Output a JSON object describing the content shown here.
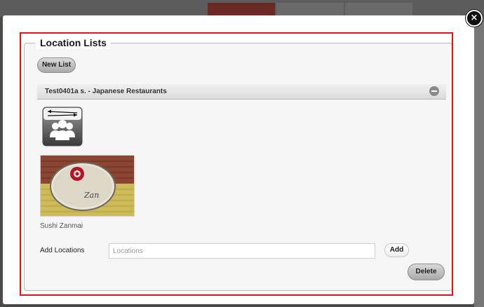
{
  "modal": {
    "close_label": "×",
    "section_title": "Location Lists",
    "new_list_label": "New List",
    "list": {
      "title": "Test0401a s. - Japanese Restaurants",
      "items": [
        {
          "name": "Sushi Zanmai"
        }
      ]
    },
    "add_locations_label": "Add Locations",
    "locations_placeholder": "Locations",
    "add_label": "Add",
    "delete_label": "Delete"
  },
  "colors": {
    "highlight": "#e1121b",
    "button_gradient_top": "#d9d9d9",
    "button_gradient_bottom": "#a9a9a9"
  },
  "icons": {
    "close": "close-icon",
    "collapse": "minus-circle-icon",
    "share": "share-group-icon"
  }
}
